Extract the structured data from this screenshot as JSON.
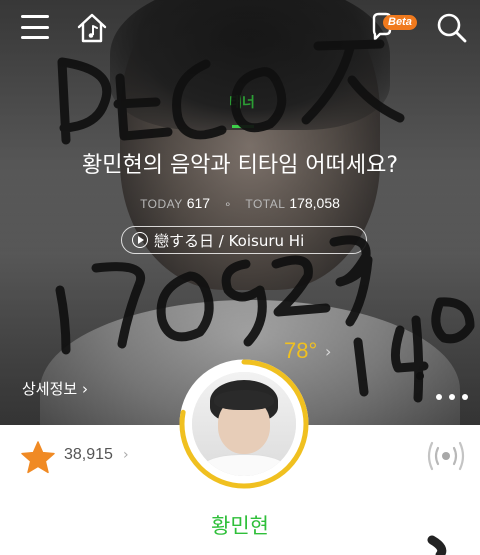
{
  "header": {
    "beta_badge": "Beta",
    "icons": [
      "menu-icon",
      "home-music-icon",
      "chat-bubble-icon",
      "search-icon"
    ]
  },
  "playlist": {
    "tag": "태너",
    "title": "황민현의 음악과 티타임 어떠세요?",
    "today_label": "TODAY",
    "today_count": "617",
    "total_label": "TOTAL",
    "total_count": "178,058",
    "now_playing": "戀する日 / Koisuru Hi",
    "detail_link": "상세정보"
  },
  "temperature": {
    "value": "78°"
  },
  "likes": {
    "count": "38,915"
  },
  "artist": {
    "name": "황민현"
  },
  "colors": {
    "accent_green": "#2fbf3a",
    "beta_orange": "#f07a1e",
    "ring_yellow": "#f0c020",
    "star_orange": "#f08a24"
  }
}
